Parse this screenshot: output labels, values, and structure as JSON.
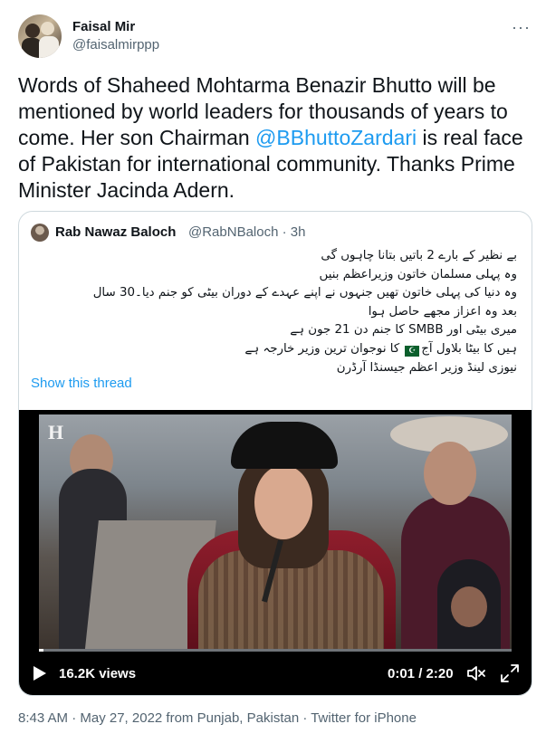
{
  "author": {
    "name": "Faisal Mir",
    "handle": "@faisalmirppp"
  },
  "more_icon": "···",
  "tweet": {
    "text_1": "Words of Shaheed Mohtarma Benazir Bhutto will be mentioned by world leaders for thousands of years to come. Her son Chairman ",
    "mention": "@BBhuttoZardari",
    "text_2": " is real face of Pakistan for international community. Thanks Prime Minister Jacinda Adern."
  },
  "quoted": {
    "name": "Rab Nawaz Baloch",
    "handle_time": "@RabNBaloch · 3h",
    "lines": [
      "بے نظیر کے بارے 2 باتیں بتانا چاہوں گی",
      "وہ پہلی مسلمان خاتون وزیراعظم بنیں",
      "وہ دنیا کی پہلی خاتون تھیں جنہوں نے اپنے عہدے کے دوران بیٹی کو جنم دیا۔30 سال",
      "بعد وہ اعزاز مجھے حاصل ہوا",
      "میری بیٹی اور SMBB کا جنم دن 21 جون ہے",
      "کا نوجوان ترین وزیر خارجہ ہے",
      "ہیں کا بیٹا بلاول آج",
      "نیوزی لینڈ وزیر اعظم جیسنڈا آرڈرن"
    ],
    "flag_icon": "pakistan-flag",
    "show_thread": "Show this thread"
  },
  "video": {
    "views": "16.2K views",
    "time": "0:01 / 2:20",
    "progress": 0.01,
    "watermark": "H"
  },
  "footer": {
    "meta": "8:43 AM · May 27, 2022 from Punjab, Pakistan · Twitter for iPhone"
  },
  "colors": {
    "accent": "#1d9bf0",
    "muted": "#536471",
    "border": "#cfd9de"
  }
}
